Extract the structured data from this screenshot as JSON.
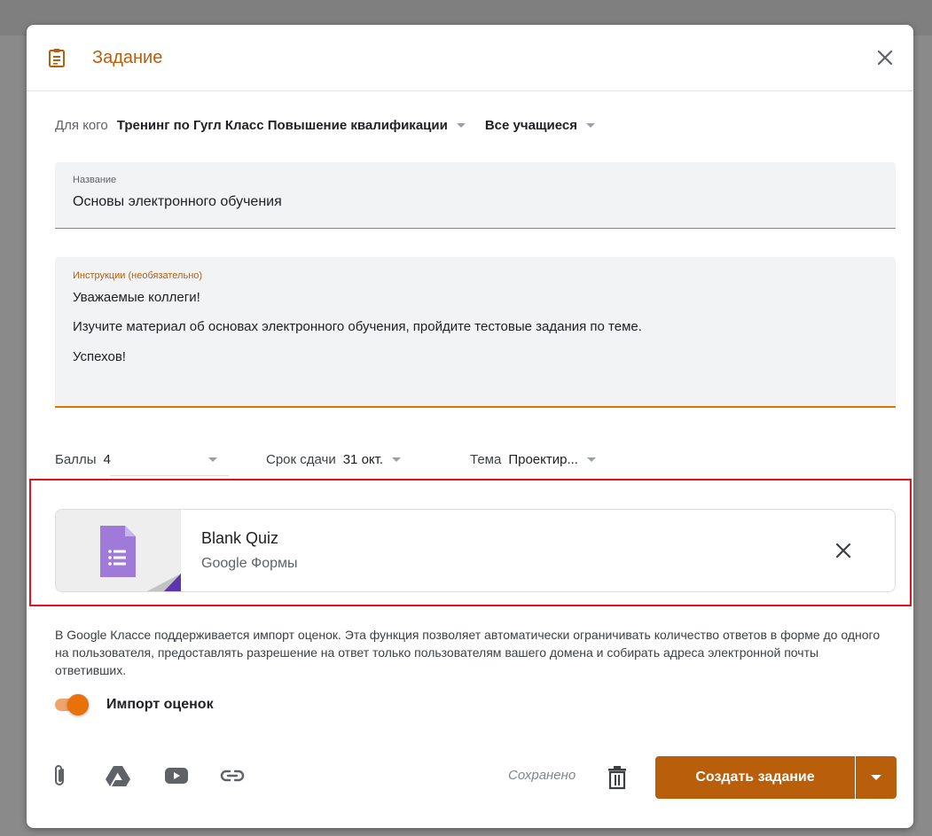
{
  "dialog": {
    "title": "Задание",
    "close_icon": "close-icon",
    "accent_color": "#b95e0a"
  },
  "for_row": {
    "label": "Для кого",
    "class_name": "Тренинг по Гугл Класс Повышение квалификации",
    "students": "Все учащиеся"
  },
  "title_field": {
    "label": "Название",
    "value": "Основы электронного обучения"
  },
  "instructions_field": {
    "label": "Инструкции (необязательно)",
    "lines": [
      "Уважаемые коллеги!",
      "Изучите материал об основах электронного обучения, пройдите тестовые задания по теме.",
      "Успехов!"
    ]
  },
  "meta": {
    "points_label": "Баллы",
    "points_value": "4",
    "due_label": "Срок сдачи",
    "due_value": "31 окт.",
    "topic_label": "Тема",
    "topic_value": "Проектир..."
  },
  "attachment": {
    "title": "Blank Quiz",
    "subtitle": "Google Формы",
    "icon": "google-forms-icon"
  },
  "import_note": "В Google Классе поддерживается импорт оценок. Эта функция позволяет автоматически ограничивать количество ответов в форме до одного на пользователя, предоставлять разрешение на ответ только пользователям вашего домена и собирать адреса электронной почты ответивших.",
  "toggle": {
    "label": "Импорт оценок",
    "on": true
  },
  "footer": {
    "saved_label": "Сохранено",
    "create_label": "Создать задание",
    "icons": [
      "attach-file-icon",
      "google-drive-icon",
      "youtube-icon",
      "link-icon",
      "trash-icon"
    ]
  }
}
